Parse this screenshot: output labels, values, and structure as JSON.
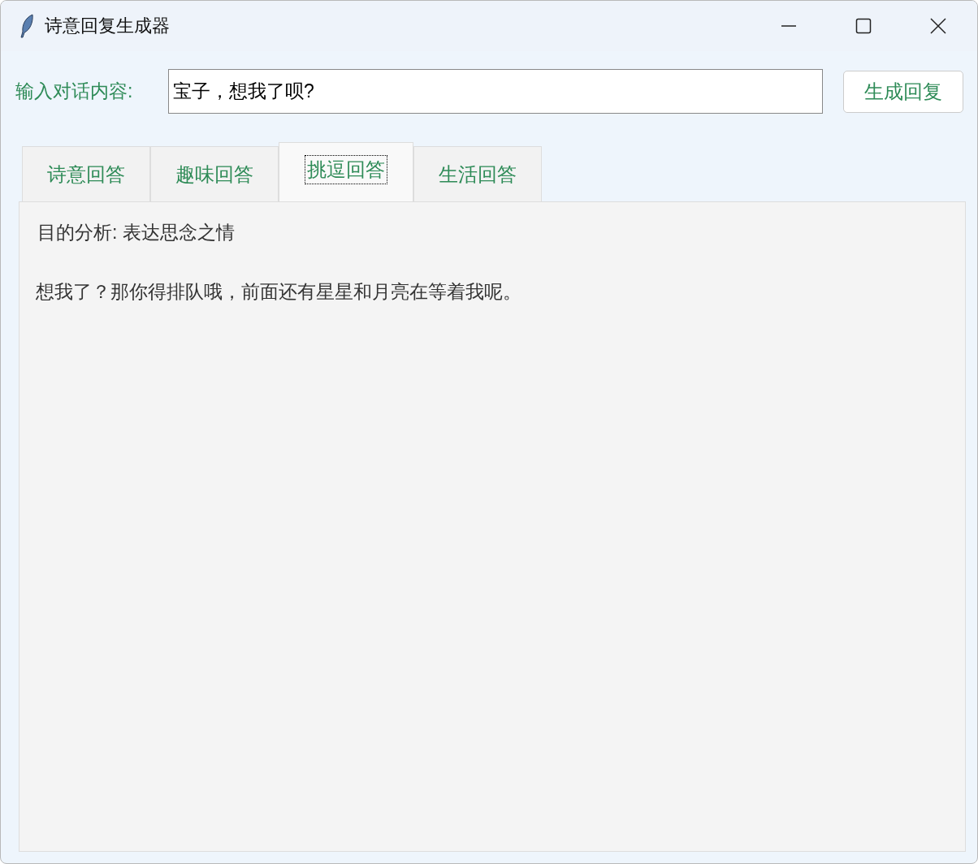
{
  "window": {
    "title": "诗意回复生成器"
  },
  "input": {
    "label": "输入对话内容:",
    "value": "宝子，想我了呗?"
  },
  "generate_button": "生成回复",
  "tabs": [
    {
      "label": "诗意回答",
      "selected": false
    },
    {
      "label": "趣味回答",
      "selected": false
    },
    {
      "label": "挑逗回答",
      "selected": true
    },
    {
      "label": "生活回答",
      "selected": false
    }
  ],
  "output": {
    "analysis": "目的分析: 表达思念之情",
    "reply": "想我了？那你得排队哦，前面还有星星和月亮在等着我呢。"
  }
}
